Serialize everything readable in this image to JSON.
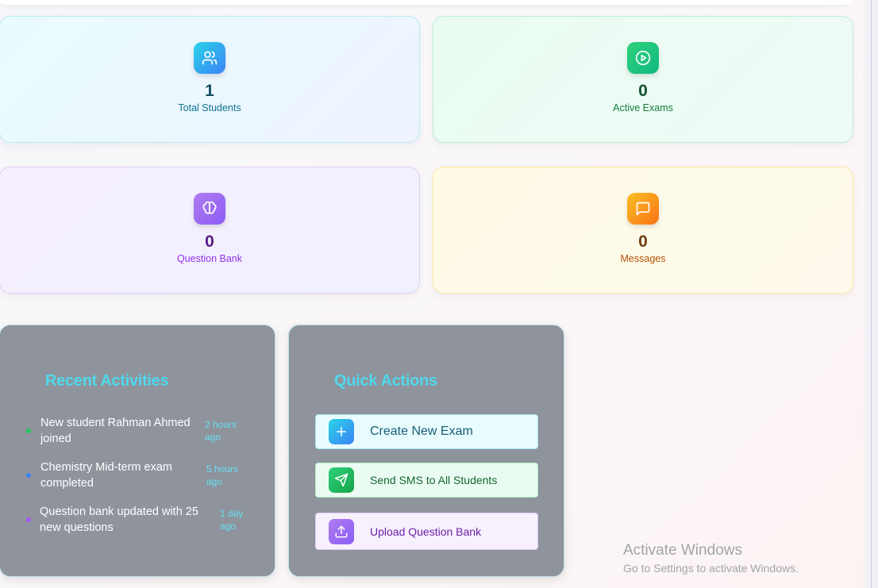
{
  "stats": {
    "students": {
      "value": "1",
      "label": "Total Students",
      "icon": "users-icon"
    },
    "exams": {
      "value": "0",
      "label": "Active Exams",
      "icon": "play-circle-icon"
    },
    "bank": {
      "value": "0",
      "label": "Question Bank",
      "icon": "brain-icon"
    },
    "messages": {
      "value": "0",
      "label": "Messages",
      "icon": "message-square-icon"
    }
  },
  "activities": {
    "title": "Recent Activities",
    "items": [
      {
        "text": "New student Rahman Ahmed joined",
        "time": "2 hours ago",
        "dot_color": "#22c55e"
      },
      {
        "text": "Chemistry Mid-term exam completed",
        "time": "5 hours ago",
        "dot_color": "#3b82f6"
      },
      {
        "text": "Question bank updated with 25 new questions",
        "time": "1 day ago",
        "dot_color": "#a855f7"
      }
    ]
  },
  "quick_actions": {
    "title": "Quick Actions",
    "buttons": [
      {
        "label": "Create New Exam",
        "icon": "plus-icon"
      },
      {
        "label": "Send SMS to All Students",
        "icon": "send-icon"
      },
      {
        "label": "Upload Question Bank",
        "icon": "upload-icon"
      }
    ]
  },
  "watermark": {
    "title": "Activate Windows",
    "subtitle": "Go to Settings to activate Windows."
  }
}
